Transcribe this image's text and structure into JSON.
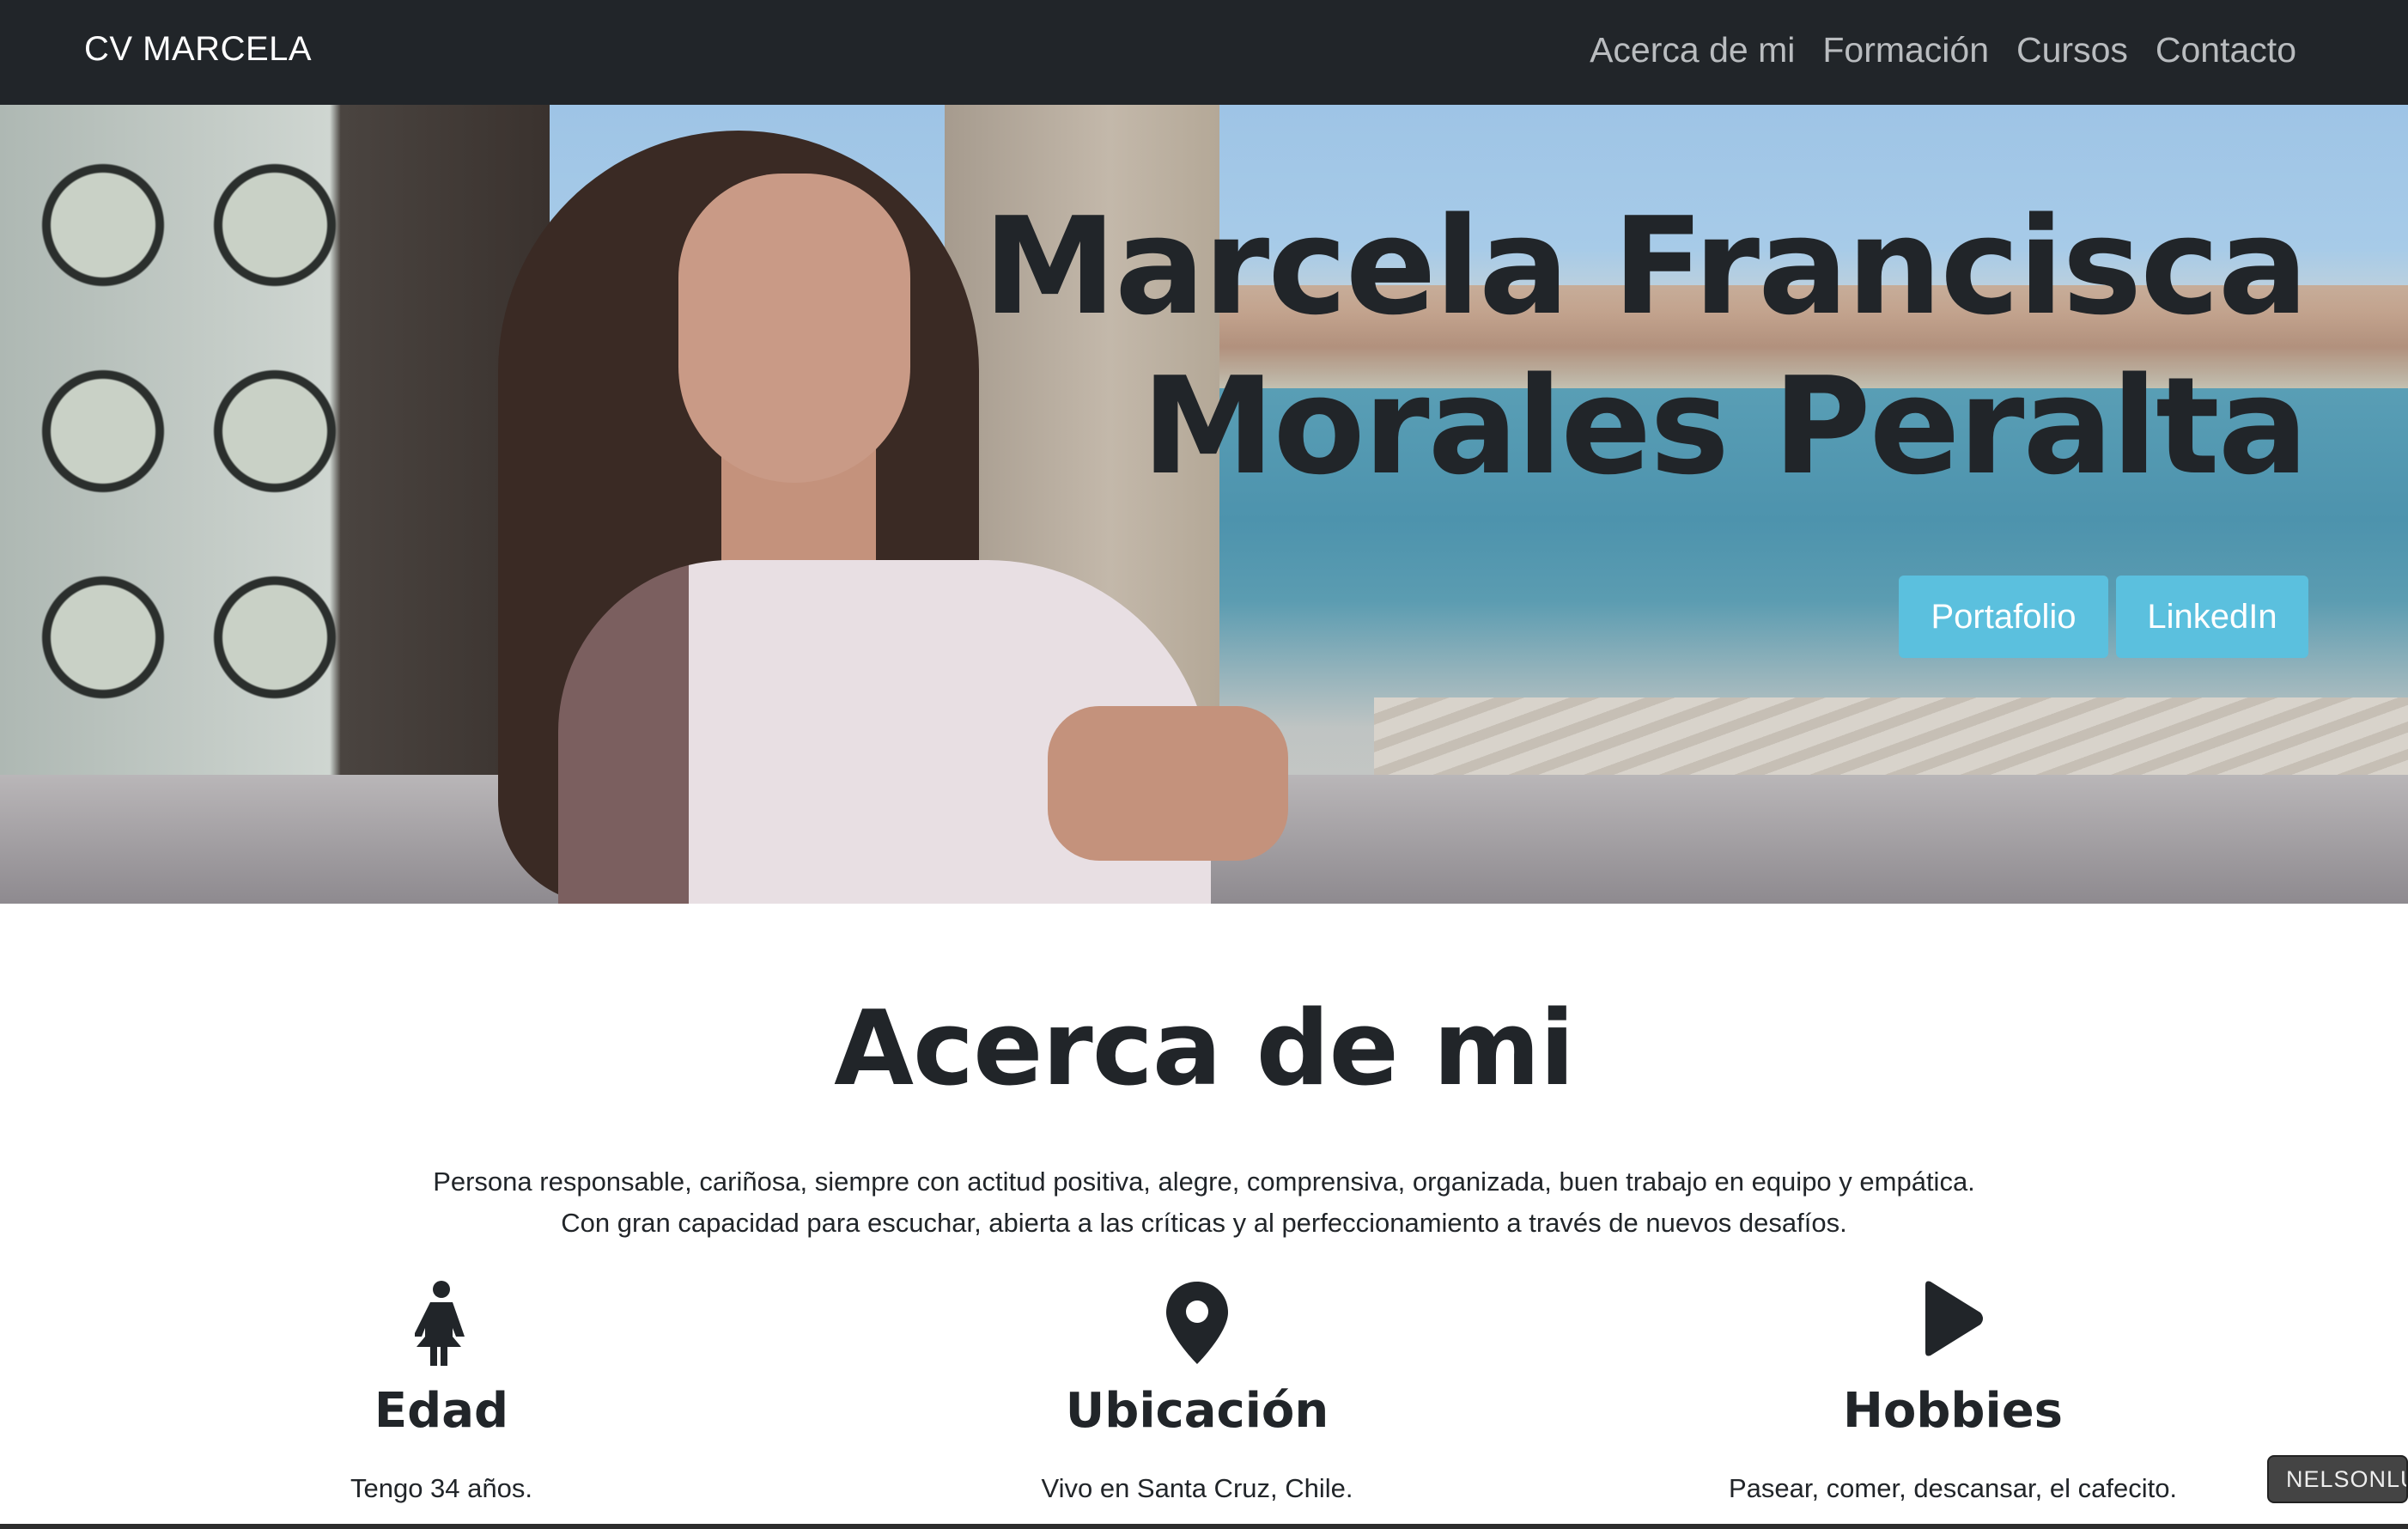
{
  "navbar": {
    "brand": "CV MARCELA",
    "links": [
      "Acerca de mi",
      "Formación",
      "Cursos",
      "Contacto"
    ]
  },
  "hero": {
    "title_line1": "Marcela Francisca",
    "title_line2": "Morales Peralta",
    "buttons": [
      "Portafolio",
      "LinkedIn"
    ],
    "button_color": "#5bc0de"
  },
  "about": {
    "title": "Acerca de mi",
    "text_line1": "Persona responsable, cariñosa, siempre con actitud positiva, alegre, comprensiva, organizada, buen trabajo en equipo y empática.",
    "text_line2": "Con gran capacidad para escuchar, abierta a las críticas y al perfeccionamiento a través de nuevos desafíos.",
    "features": [
      {
        "icon": "female-person-icon",
        "title": "Edad",
        "text": "Tengo 34 años."
      },
      {
        "icon": "map-marker-icon",
        "title": "Ubicación",
        "text": "Vivo en Santa Cruz, Chile."
      },
      {
        "icon": "play-icon",
        "title": "Hobbies",
        "text": "Pasear, comer, descansar, el cafecito."
      }
    ]
  },
  "badge": "NELSONLU",
  "colors": {
    "navbar": "#212529",
    "text": "#212529",
    "nav_link": "#b9bcbf"
  }
}
